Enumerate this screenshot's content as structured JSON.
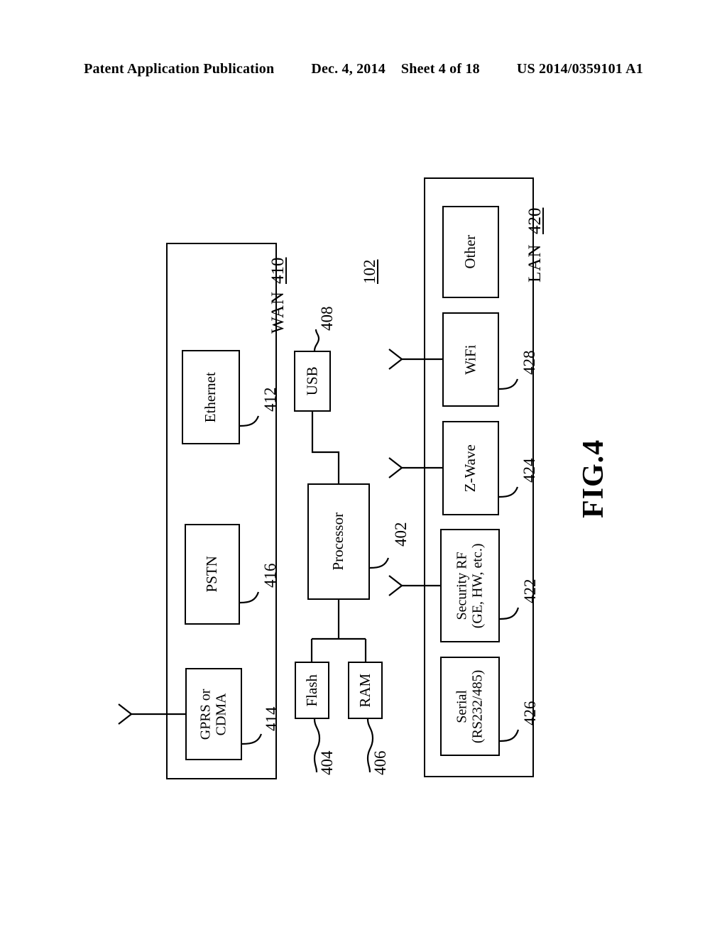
{
  "header": {
    "publication": "Patent Application Publication",
    "date": "Dec. 4, 2014",
    "sheet": "Sheet 4 of 18",
    "patent_number": "US 2014/0359101 A1"
  },
  "figure": {
    "label": "FIG.4",
    "system_ref": "102"
  },
  "groups": [
    {
      "id": "wan",
      "name": "WAN",
      "ref": "410",
      "boxes": [
        {
          "id": "ethernet",
          "label": "Ethernet",
          "ref": "412"
        },
        {
          "id": "pstn",
          "label": "PSTN",
          "ref": "416"
        },
        {
          "id": "gprs-cdma",
          "label_line1": "GPRS or",
          "label_line2": "CDMA",
          "ref": "414"
        }
      ]
    },
    {
      "id": "lan",
      "name": "LAN",
      "ref": "420",
      "boxes": [
        {
          "id": "other",
          "label": "Other",
          "ref": ""
        },
        {
          "id": "wifi",
          "label": "WiFi",
          "ref": "428"
        },
        {
          "id": "zwave",
          "label": "Z-Wave",
          "ref": "424"
        },
        {
          "id": "security-rf",
          "label_line1": "Security RF",
          "label_line2": "(GE, HW, etc.)",
          "ref": "422"
        },
        {
          "id": "serial",
          "label_line1": "Serial",
          "label_line2": "(RS232/485)",
          "ref": "426"
        }
      ]
    }
  ],
  "core": {
    "usb": {
      "label": "USB",
      "ref": "408"
    },
    "processor": {
      "label": "Processor",
      "ref": "402"
    },
    "flash": {
      "label": "Flash",
      "ref": "404"
    },
    "ram": {
      "label": "RAM",
      "ref": "406"
    }
  },
  "colors": {
    "ink": "#000000",
    "paper": "#ffffff"
  }
}
